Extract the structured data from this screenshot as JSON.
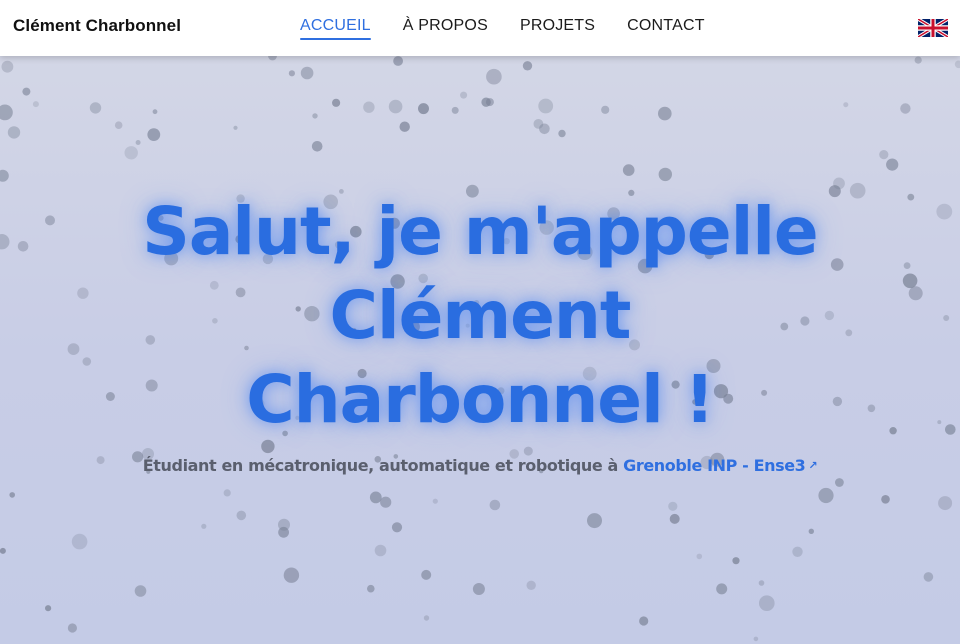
{
  "navbar": {
    "brand": "Clément Charbonnel",
    "links": [
      {
        "label": "ACCUEIL",
        "active": true
      },
      {
        "label": "À PROPOS",
        "active": false
      },
      {
        "label": "PROJETS",
        "active": false
      },
      {
        "label": "CONTACT",
        "active": false
      }
    ],
    "language_icon": "uk-flag-icon"
  },
  "hero": {
    "title_line1": "Salut, je m'appelle",
    "title_line2": "Clément",
    "title_line3": "Charbonnel !",
    "subtitle_text": "Étudiant en mécatronique, automatique et robotique à ",
    "subtitle_link": "Grenoble INP - Ense3",
    "link_icon": "external-link-icon"
  },
  "colors": {
    "accent": "#2f6fe0",
    "title": "#2a6de0",
    "particle": "#7a8296",
    "background": "#c8cde6"
  }
}
